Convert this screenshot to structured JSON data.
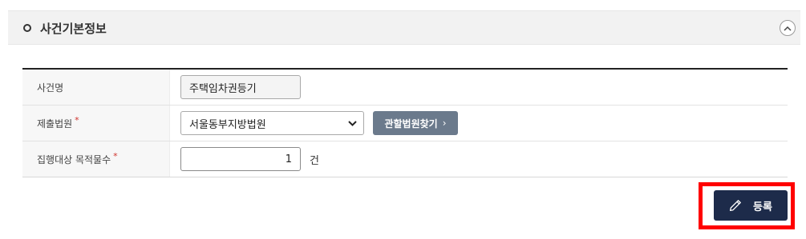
{
  "section": {
    "title": "사건기본정보",
    "collapse_icon": "chevron-up-icon"
  },
  "form": {
    "case_name": {
      "label": "사건명",
      "value": "주택임차권등기"
    },
    "court": {
      "label": "제출법원",
      "required": "*",
      "selected": "서울동부지방법원",
      "find_button": "관할법원찾기",
      "find_button_icon": "chevron-right-icon"
    },
    "target_count": {
      "label": "집행대상 목적물수",
      "required": "*",
      "value": "1",
      "unit": "건"
    }
  },
  "actions": {
    "register_label": "등록",
    "register_icon": "pencil-icon"
  },
  "colors": {
    "header_bg": "#f2f2f2",
    "label_bg": "#f7f7f7",
    "find_button_bg": "#6b7a8c",
    "register_button_bg": "#1d2b4a",
    "required": "#d0332e",
    "highlight": "#ff0000"
  }
}
